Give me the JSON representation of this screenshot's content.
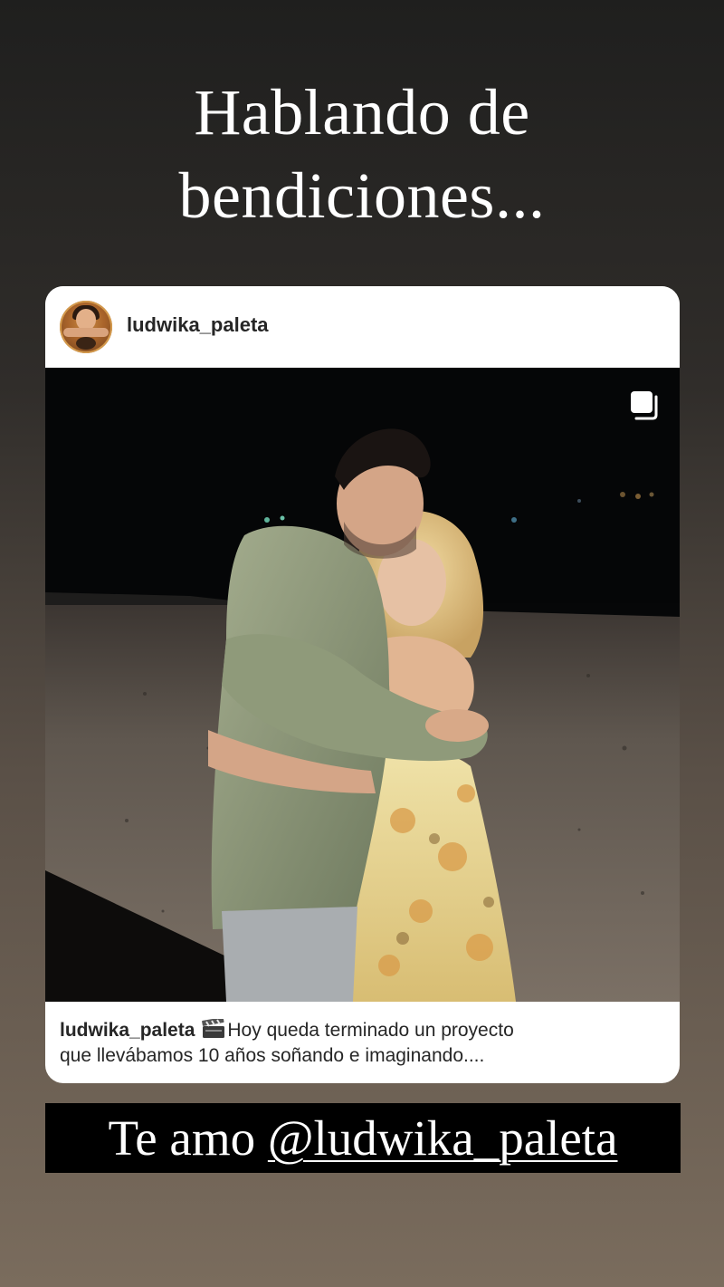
{
  "headline": {
    "line1": "Hablando de",
    "line2": "bendiciones..."
  },
  "post": {
    "username": "ludwika_paleta",
    "avatar": "profile-avatar",
    "carousel_icon": "multiple-images-icon",
    "caption": {
      "username": "ludwika_paleta",
      "emoji_icon": "clapper-board-icon",
      "line1": "Hoy queda terminado un proyecto",
      "line2": "que llevábamos 10 años soñando e imaginando...."
    }
  },
  "sticker": {
    "prefix": "Te amo",
    "mention": "@ludwika_paleta"
  }
}
